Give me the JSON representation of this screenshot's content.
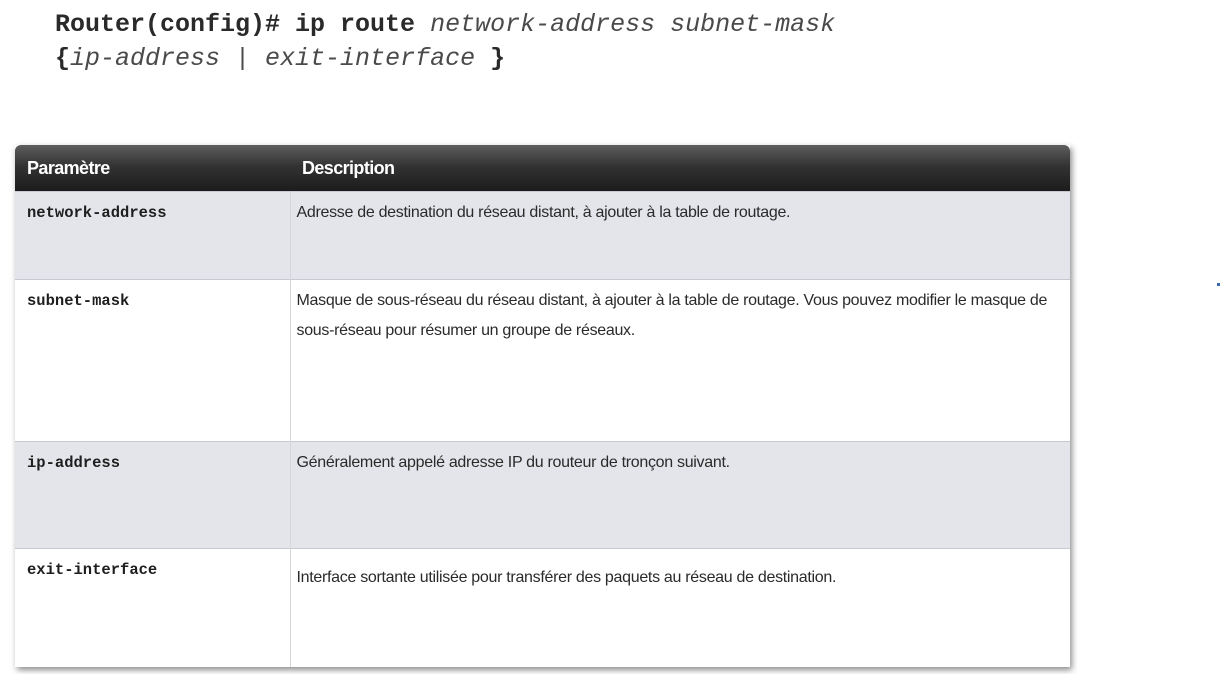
{
  "syntax": {
    "line1_prefix": "Router(config)# ip route ",
    "line1_args": "network-address subnet-mask",
    "line2_open": "{",
    "line2_args": "ip-address | exit-interface",
    "line2_close": "}"
  },
  "table": {
    "headers": [
      "Paramètre",
      "Description"
    ],
    "rows": [
      {
        "param": "network-address",
        "description": "Adresse de destination du réseau distant, à ajouter à la table de routage."
      },
      {
        "param": "subnet-mask",
        "description": "Masque de sous-réseau du réseau distant, à ajouter à la table de routage.  Vous pouvez modifier le masque de sous-réseau pour résumer un groupe de réseaux."
      },
      {
        "param": "ip-address",
        "description": "Généralement appelé adresse IP du routeur de tronçon suivant."
      },
      {
        "param": "exit-interface",
        "description": "Interface sortante utilisée pour transférer des paquets au réseau de destination."
      }
    ]
  }
}
